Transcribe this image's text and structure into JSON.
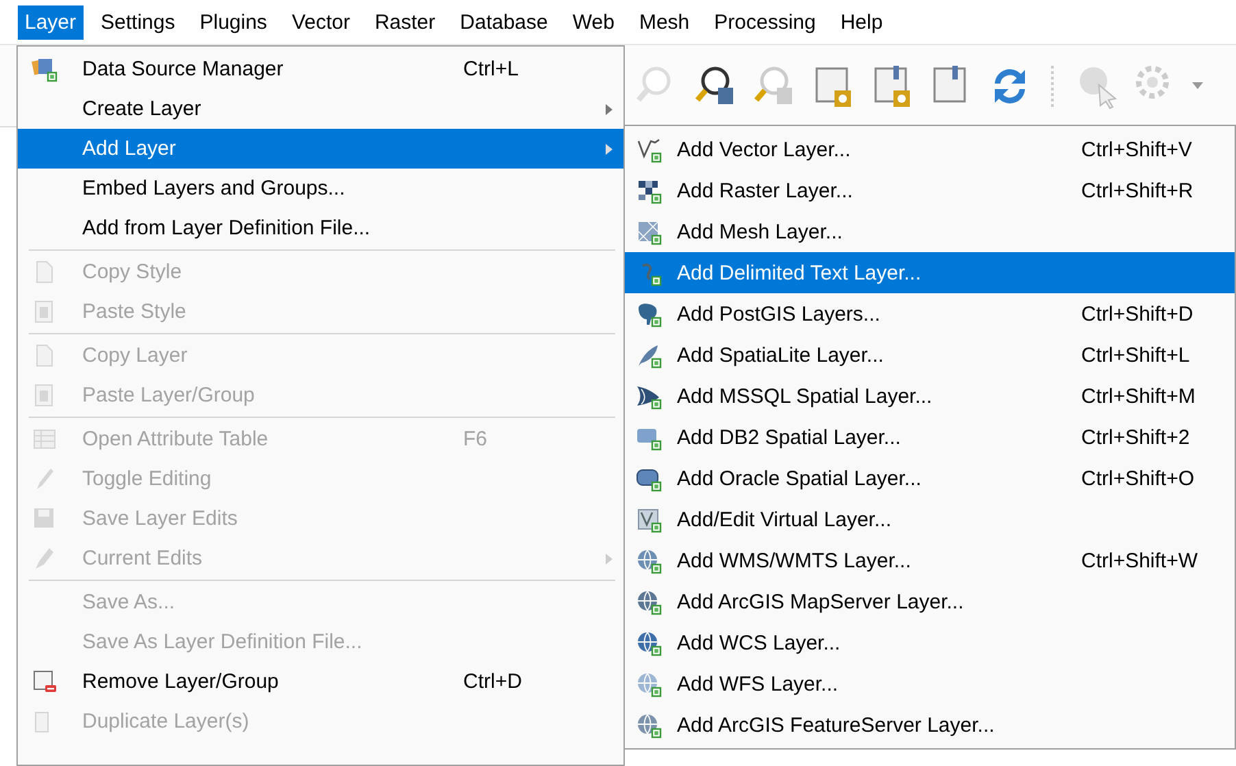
{
  "menubar": [
    {
      "label": "Layer",
      "selected": true
    },
    {
      "label": "Settings",
      "selected": false
    },
    {
      "label": "Plugins",
      "selected": false
    },
    {
      "label": "Vector",
      "selected": false
    },
    {
      "label": "Raster",
      "selected": false
    },
    {
      "label": "Database",
      "selected": false
    },
    {
      "label": "Web",
      "selected": false
    },
    {
      "label": "Mesh",
      "selected": false
    },
    {
      "label": "Processing",
      "selected": false
    },
    {
      "label": "Help",
      "selected": false
    }
  ],
  "layer_menu": {
    "items": [
      {
        "kind": "item",
        "label": "Data Source Manager",
        "shortcut": "Ctrl+L",
        "disabled": false,
        "submenu": false,
        "selected": false
      },
      {
        "kind": "item",
        "label": "Create Layer",
        "disabled": false,
        "submenu": true,
        "selected": false
      },
      {
        "kind": "item",
        "label": "Add Layer",
        "disabled": false,
        "submenu": true,
        "selected": true
      },
      {
        "kind": "item",
        "label": "Embed Layers and Groups...",
        "disabled": false,
        "submenu": false,
        "selected": false
      },
      {
        "kind": "item",
        "label": "Add from Layer Definition File...",
        "disabled": false,
        "submenu": false,
        "selected": false
      },
      {
        "kind": "separator"
      },
      {
        "kind": "item",
        "label": "Copy Style",
        "disabled": true,
        "submenu": false,
        "selected": false
      },
      {
        "kind": "item",
        "label": "Paste Style",
        "disabled": true,
        "submenu": false,
        "selected": false
      },
      {
        "kind": "separator"
      },
      {
        "kind": "item",
        "label": "Copy Layer",
        "disabled": true,
        "submenu": false,
        "selected": false
      },
      {
        "kind": "item",
        "label": "Paste Layer/Group",
        "disabled": true,
        "submenu": false,
        "selected": false
      },
      {
        "kind": "separator"
      },
      {
        "kind": "item",
        "label": "Open Attribute Table",
        "shortcut": "F6",
        "disabled": true,
        "submenu": false,
        "selected": false
      },
      {
        "kind": "item",
        "label": "Toggle Editing",
        "disabled": true,
        "submenu": false,
        "selected": false
      },
      {
        "kind": "item",
        "label": "Save Layer Edits",
        "disabled": true,
        "submenu": false,
        "selected": false
      },
      {
        "kind": "item",
        "label": "Current Edits",
        "disabled": true,
        "submenu": true,
        "selected": false
      },
      {
        "kind": "separator"
      },
      {
        "kind": "item",
        "label": "Save As...",
        "disabled": true,
        "submenu": false,
        "selected": false
      },
      {
        "kind": "item",
        "label": "Save As Layer Definition File...",
        "disabled": true,
        "submenu": false,
        "selected": false
      },
      {
        "kind": "item",
        "label": "Remove Layer/Group",
        "shortcut": "Ctrl+D",
        "disabled": false,
        "submenu": false,
        "selected": false
      },
      {
        "kind": "item",
        "label": "Duplicate Layer(s)",
        "disabled": true,
        "submenu": false,
        "selected": false
      }
    ]
  },
  "add_layer_submenu": {
    "items": [
      {
        "kind": "item",
        "label": "Add Vector Layer...",
        "shortcut": "Ctrl+Shift+V",
        "disabled": false,
        "submenu": false,
        "selected": false
      },
      {
        "kind": "item",
        "label": "Add Raster Layer...",
        "shortcut": "Ctrl+Shift+R",
        "disabled": false,
        "submenu": false,
        "selected": false
      },
      {
        "kind": "item",
        "label": "Add Mesh Layer...",
        "disabled": false,
        "submenu": false,
        "selected": false
      },
      {
        "kind": "item",
        "label": "Add Delimited Text Layer...",
        "disabled": false,
        "submenu": false,
        "selected": true
      },
      {
        "kind": "item",
        "label": "Add PostGIS Layers...",
        "shortcut": "Ctrl+Shift+D",
        "disabled": false,
        "submenu": false,
        "selected": false
      },
      {
        "kind": "item",
        "label": "Add SpatiaLite Layer...",
        "shortcut": "Ctrl+Shift+L",
        "disabled": false,
        "submenu": false,
        "selected": false
      },
      {
        "kind": "item",
        "label": "Add MSSQL Spatial Layer...",
        "shortcut": "Ctrl+Shift+M",
        "disabled": false,
        "submenu": false,
        "selected": false
      },
      {
        "kind": "item",
        "label": "Add DB2 Spatial Layer...",
        "shortcut": "Ctrl+Shift+2",
        "disabled": false,
        "submenu": false,
        "selected": false
      },
      {
        "kind": "item",
        "label": "Add Oracle Spatial Layer...",
        "shortcut": "Ctrl+Shift+O",
        "disabled": false,
        "submenu": false,
        "selected": false
      },
      {
        "kind": "item",
        "label": "Add/Edit Virtual Layer...",
        "disabled": false,
        "submenu": false,
        "selected": false
      },
      {
        "kind": "item",
        "label": "Add WMS/WMTS Layer...",
        "shortcut": "Ctrl+Shift+W",
        "disabled": false,
        "submenu": false,
        "selected": false
      },
      {
        "kind": "item",
        "label": "Add ArcGIS MapServer Layer...",
        "disabled": false,
        "submenu": false,
        "selected": false
      },
      {
        "kind": "item",
        "label": "Add WCS Layer...",
        "disabled": false,
        "submenu": false,
        "selected": false
      },
      {
        "kind": "item",
        "label": "Add WFS Layer...",
        "disabled": false,
        "submenu": false,
        "selected": false
      },
      {
        "kind": "item",
        "label": "Add ArcGIS FeatureServer Layer...",
        "disabled": false,
        "submenu": false,
        "selected": false
      }
    ]
  }
}
